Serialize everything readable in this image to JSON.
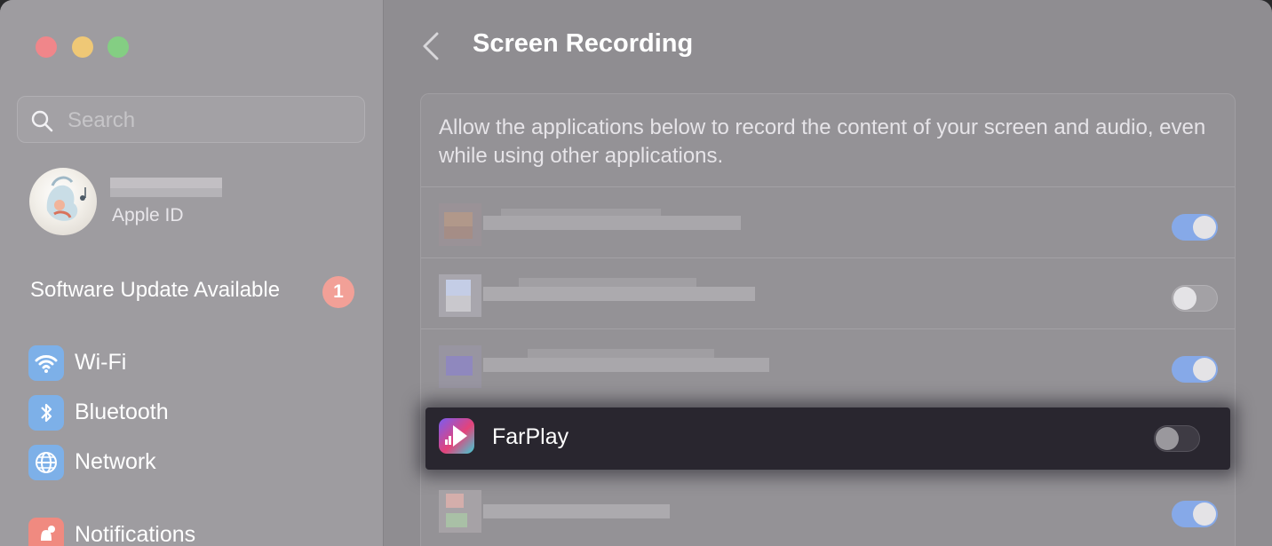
{
  "sidebar": {
    "search_placeholder": "Search",
    "apple_id_label": "Apple ID",
    "software_update": {
      "label": "Software Update Available",
      "badge": "1"
    },
    "items": [
      {
        "label": "Wi-Fi",
        "icon": "wifi-icon",
        "icon_color": "#7db0e8"
      },
      {
        "label": "Bluetooth",
        "icon": "bluetooth-icon",
        "icon_color": "#7db0e8"
      },
      {
        "label": "Network",
        "icon": "globe-icon",
        "icon_color": "#7db0e8"
      },
      {
        "label": "Notifications",
        "icon": "bell-icon",
        "icon_color": "#f08a80"
      }
    ]
  },
  "main": {
    "title": "Screen Recording",
    "description": "Allow the applications below to record the content of your screen and audio, even while using other applications.",
    "apps": [
      {
        "name": "",
        "enabled": true,
        "obscured": true
      },
      {
        "name": "",
        "enabled": false,
        "obscured": true
      },
      {
        "name": "",
        "enabled": true,
        "obscured": true
      },
      {
        "name": "FarPlay",
        "enabled": false,
        "obscured": false,
        "highlighted": true
      },
      {
        "name": "",
        "enabled": true,
        "obscured": true
      }
    ]
  },
  "colors": {
    "accent_toggle_on": "#86a9e8",
    "badge": "#f2a097",
    "highlight_row": "#29262f"
  }
}
